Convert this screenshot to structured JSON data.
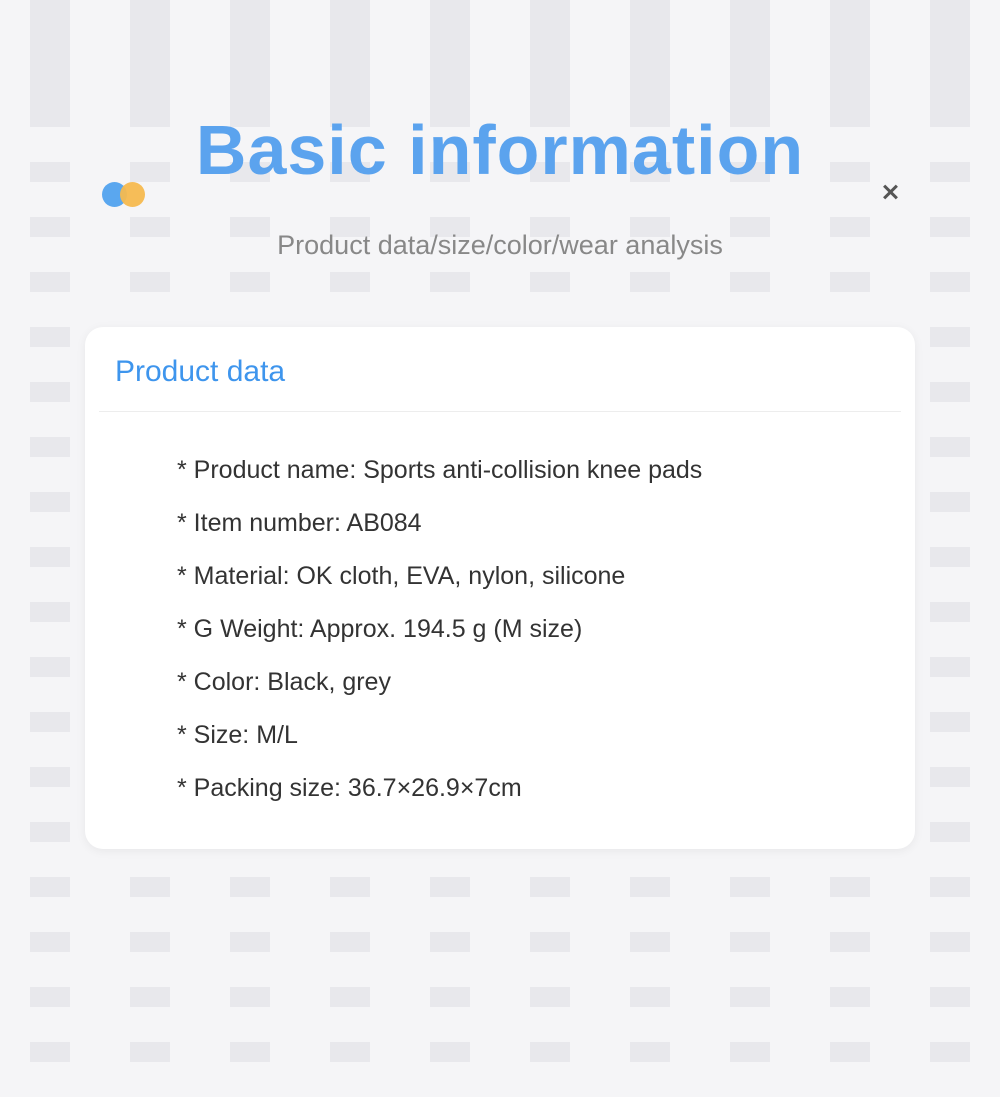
{
  "header": {
    "title": "Basic information",
    "subtitle": "Product data/size/color/wear analysis"
  },
  "card": {
    "heading": "Product data",
    "items": [
      "* Product name: Sports anti-collision knee pads",
      "* Item number: AB084",
      "* Material: OK cloth, EVA, nylon, silicone",
      "* G Weight: Approx. 194.5 g (M size)",
      "* Color: Black, grey",
      "* Size: M/L",
      "* Packing size: 36.7×26.9×7cm"
    ]
  }
}
